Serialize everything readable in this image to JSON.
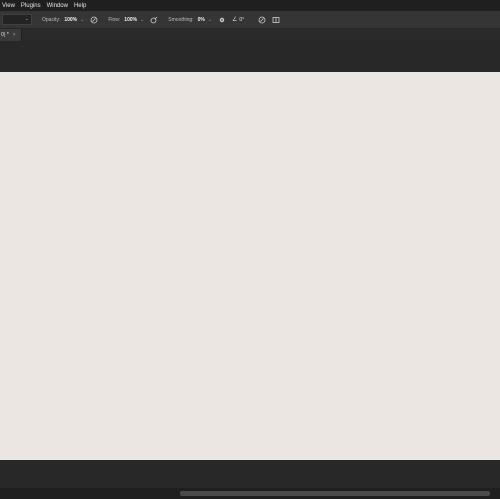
{
  "menu": {
    "items": [
      "View",
      "Plugins",
      "Window",
      "Help"
    ]
  },
  "options_bar": {
    "opacity_label": "Opacity:",
    "opacity_value": "100%",
    "flow_label": "Flow:",
    "flow_value": "100%",
    "smoothing_label": "Smoothing:",
    "smoothing_value": "0%",
    "angle_value": "0°",
    "icons": {
      "tool_preset_chevron": "chevron-down-icon",
      "pressure_opacity": "pressure-opacity-icon",
      "airbrush": "airbrush-icon",
      "smoothing_options": "gear-icon",
      "angle": "angle-icon",
      "pressure_size": "pressure-size-icon",
      "symmetry": "butterfly-icon"
    }
  },
  "document_tab": {
    "label": "0) *",
    "close": "×"
  },
  "colors": {
    "canvas": "#ebe6e1",
    "ui_dark": "#2b2b2b",
    "menubar": "#1f1f1f",
    "options_bar": "#353535"
  }
}
